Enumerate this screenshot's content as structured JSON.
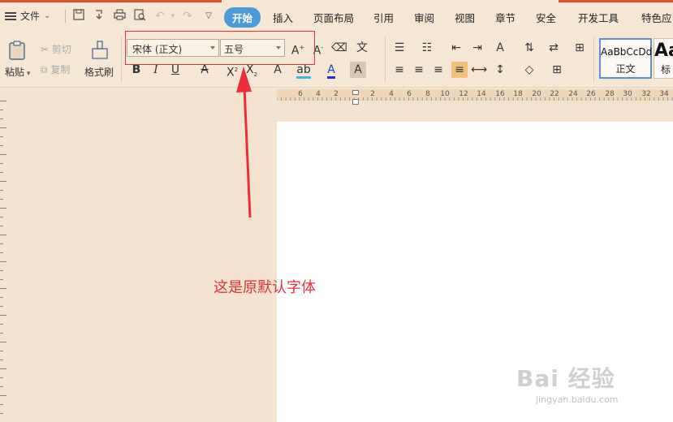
{
  "menu": {
    "file_label": "文件",
    "tabs": [
      "开始",
      "插入",
      "页面布局",
      "引用",
      "审阅",
      "视图",
      "章节",
      "安全",
      "开发工具",
      "特色应"
    ]
  },
  "ribbon": {
    "paste": "粘贴",
    "cut": "剪切",
    "copy": "复制",
    "format_painter": "格式刷",
    "font_name": "宋体 (正文)",
    "font_size": "五号",
    "styles": [
      {
        "sample": "AaBbCcDd",
        "name": "正文"
      },
      {
        "sample": "Aa",
        "name": "标"
      }
    ]
  },
  "ruler": {
    "numbers": [
      "6",
      "4",
      "2",
      "2",
      "4",
      "6",
      "8",
      "10",
      "12",
      "14",
      "16",
      "18",
      "20",
      "22",
      "24",
      "26",
      "28",
      "30",
      "32",
      "34"
    ]
  },
  "annotation": "这是原默认字体",
  "watermark": {
    "text": "Bai 经验",
    "url": "jingyan.baidu.com"
  },
  "colors": {
    "annotation": "#e0323b",
    "active_tab": "#4a9bd9",
    "background": "#f3e3cf"
  }
}
